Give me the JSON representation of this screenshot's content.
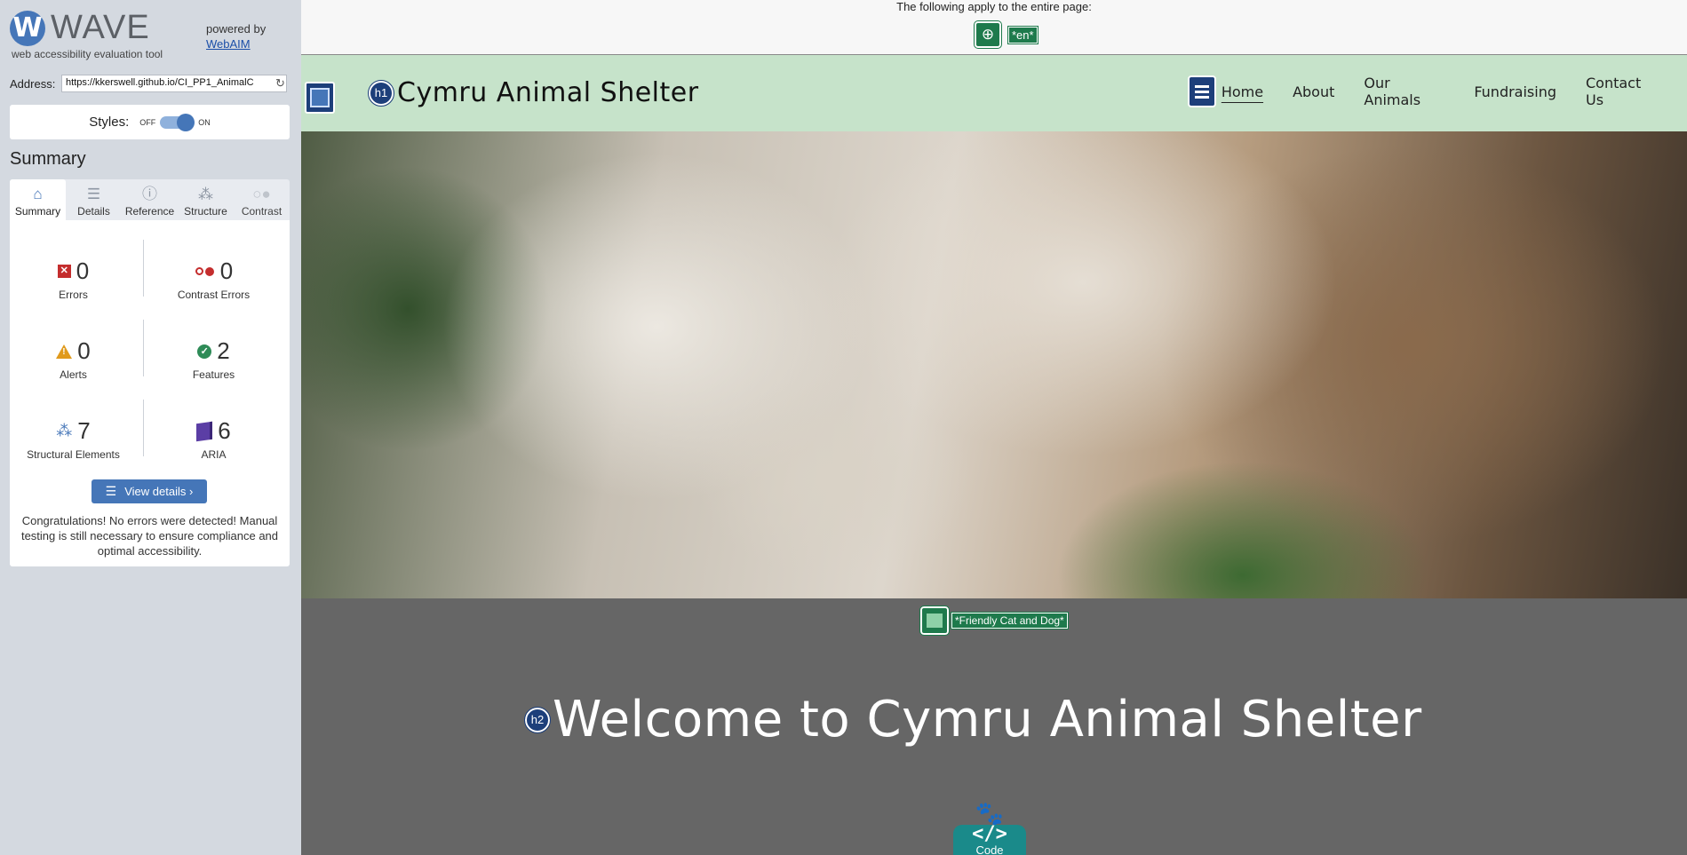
{
  "wave": {
    "logo_letter": "W",
    "logo_word": "WAVE",
    "tagline": "web accessibility evaluation tool",
    "powered_by": "powered by",
    "powered_link": "WebAIM",
    "address_label": "Address:",
    "address_value": "https://kkerswell.github.io/CI_PP1_AnimalC",
    "styles_label": "Styles:",
    "styles_off": "OFF",
    "styles_on": "ON",
    "summary_heading": "Summary",
    "tabs": [
      {
        "label": "Summary",
        "icon": "home-icon",
        "glyph": "⌂"
      },
      {
        "label": "Details",
        "icon": "list-icon",
        "glyph": "☰"
      },
      {
        "label": "Reference",
        "icon": "info-icon",
        "glyph": "ⓘ"
      },
      {
        "label": "Structure",
        "icon": "structure-icon",
        "glyph": "⁂"
      },
      {
        "label": "Contrast",
        "icon": "contrast-icon",
        "glyph": "○●"
      }
    ],
    "stats": {
      "errors": {
        "value": "0",
        "label": "Errors"
      },
      "contrast_errors": {
        "value": "0",
        "label": "Contrast Errors"
      },
      "alerts": {
        "value": "0",
        "label": "Alerts"
      },
      "features": {
        "value": "2",
        "label": "Features"
      },
      "structural": {
        "value": "7",
        "label": "Structural Elements"
      },
      "aria": {
        "value": "6",
        "label": "ARIA"
      }
    },
    "view_details": "View details ›",
    "congrats": "Congratulations! No errors were detected! Manual testing is still necessary to ensure compliance and optimal accessibility.",
    "colors": {
      "accent": "#4576b8",
      "error": "#c42d2d",
      "alert": "#e09a1c",
      "feature": "#2e8b57",
      "aria": "#5b3ea5"
    }
  },
  "page": {
    "topbar_text": "The following apply to the entire page:",
    "lang_tag": "*en*",
    "h1_badge": "h1",
    "site_title": "Cymru Animal Shelter",
    "nav": [
      "Home",
      "About",
      "Our Animals",
      "Fundraising",
      "Contact Us"
    ],
    "alt_text": "*Friendly Cat and Dog*",
    "h2_badge": "h2",
    "welcome_title": "Welcome to Cymru Animal Shelter",
    "code_label": "Code",
    "code_symbol": "</>",
    "colors": {
      "header_bg": "#c6e3ca",
      "body_bg": "#666666",
      "wave_green": "#1e7a4c",
      "wave_blue": "#1d3f7a",
      "code_teal": "#1a8a8a"
    }
  }
}
